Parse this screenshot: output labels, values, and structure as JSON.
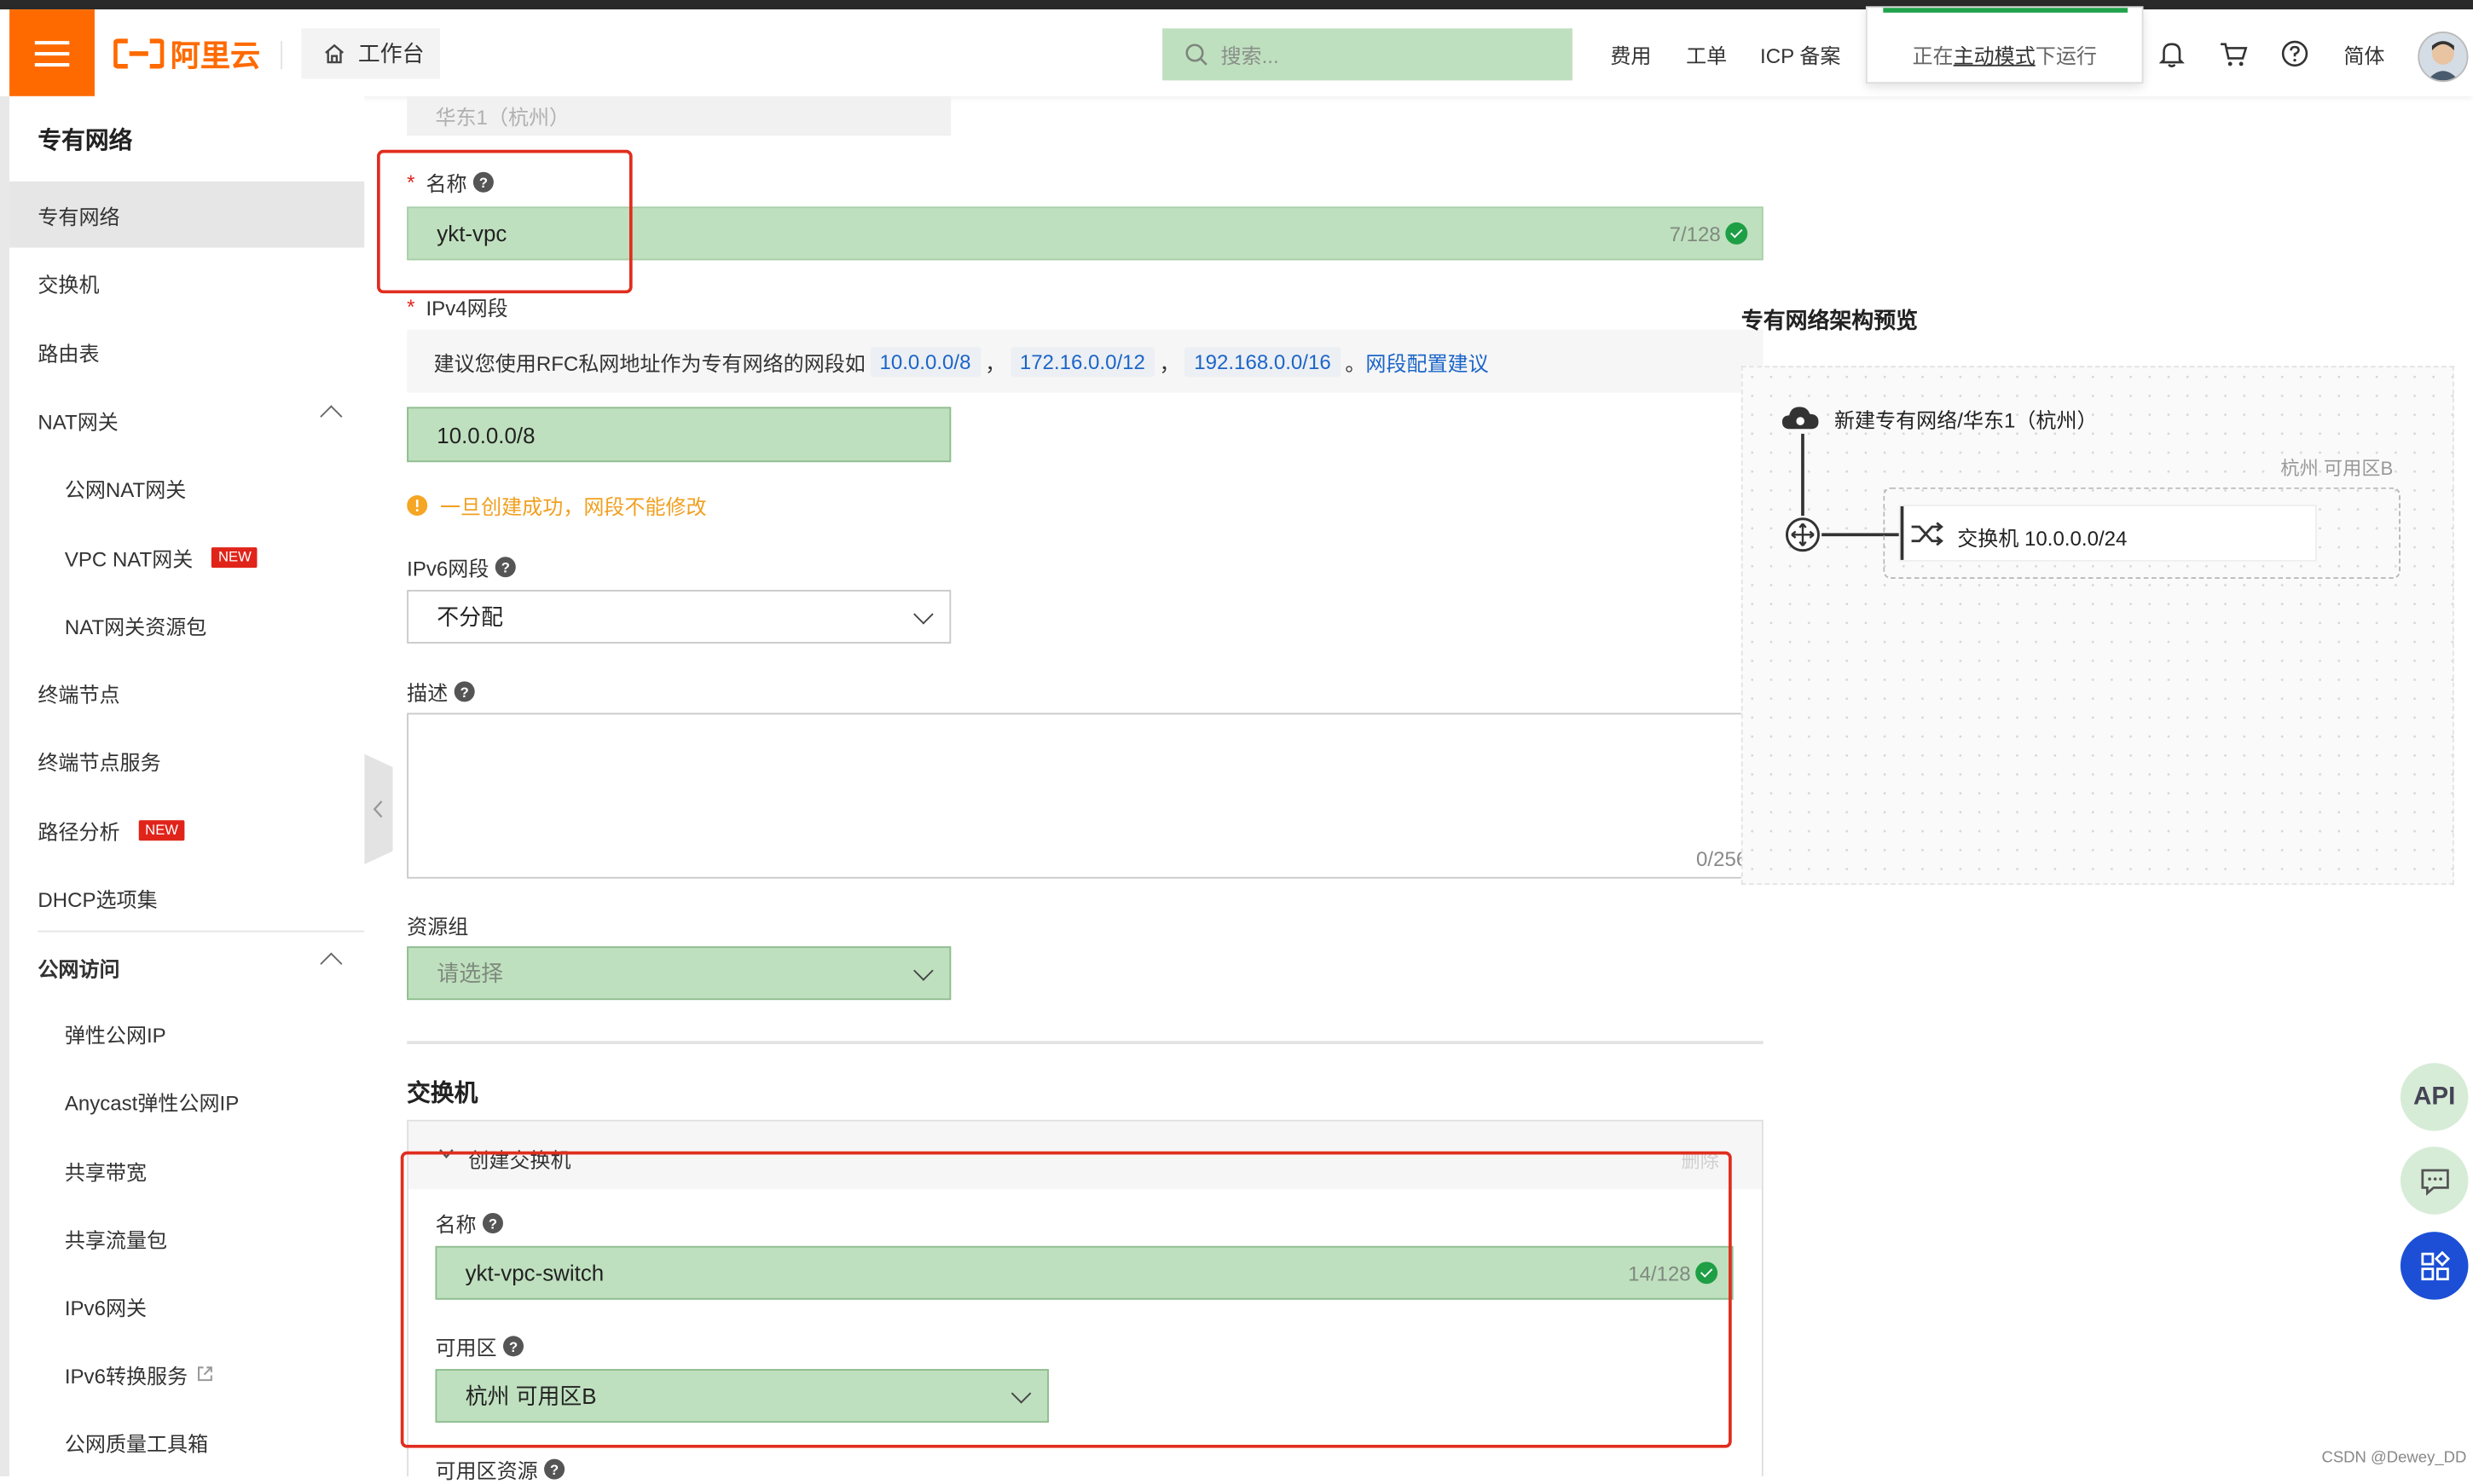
{
  "header": {
    "brand": "阿里云",
    "workbench": "工作台",
    "search_placeholder": "搜索...",
    "links": [
      "费用",
      "工单",
      "ICP 备案"
    ],
    "mode_prefix": "正在",
    "mode_link": "主动模式",
    "mode_suffix": "下运行",
    "lang": "简体"
  },
  "sidebar": {
    "title": "专有网络",
    "items": [
      {
        "label": "专有网络"
      },
      {
        "label": "交换机"
      },
      {
        "label": "路由表"
      },
      {
        "label": "NAT网关"
      },
      {
        "label": "公网NAT网关"
      },
      {
        "label": "VPC NAT网关",
        "badge": "NEW"
      },
      {
        "label": "NAT网关资源包"
      },
      {
        "label": "终端节点"
      },
      {
        "label": "终端节点服务"
      },
      {
        "label": "路径分析",
        "badge": "NEW"
      },
      {
        "label": "DHCP选项集"
      },
      {
        "label": "公网访问"
      },
      {
        "label": "弹性公网IP"
      },
      {
        "label": "Anycast弹性公网IP"
      },
      {
        "label": "共享带宽"
      },
      {
        "label": "共享流量包"
      },
      {
        "label": "IPv6网关"
      },
      {
        "label": "IPv6转换服务"
      },
      {
        "label": "公网质量工具箱"
      }
    ]
  },
  "form": {
    "region_value": "华东1（杭州）",
    "name_label": "名称",
    "name_value": "ykt-vpc",
    "name_counter": "7/128",
    "ipv4_label": "IPv4网段",
    "ipv4_hint": "建议您使用RFC私网地址作为专有网络的网段如",
    "cidr_tags": [
      "10.0.0.0/8",
      "172.16.0.0/12",
      "192.168.0.0/16"
    ],
    "cidr_sep": "，",
    "hint_end": "。",
    "cidr_advice_link": "网段配置建议",
    "ipv4_value": "10.0.0.0/8",
    "ipv4_warning": "一旦创建成功，网段不能修改",
    "ipv6_label": "IPv6网段",
    "ipv6_value": "不分配",
    "desc_label": "描述",
    "desc_counter": "0/256",
    "rg_label": "资源组",
    "rg_placeholder": "请选择",
    "switch_section_title": "交换机",
    "switch_panel_title": "创建交换机",
    "switch_delete": "删除",
    "switch_name_label": "名称",
    "switch_name_value": "ykt-vpc-switch",
    "switch_name_counter": "14/128",
    "zone_label": "可用区",
    "zone_value": "杭州 可用区B",
    "zone_resource_label": "可用区资源"
  },
  "preview": {
    "title": "专有网络架构预览",
    "vpc_node": "新建专有网络/华东1（杭州）",
    "zone_label": "杭州 可用区B",
    "switch_node": "交换机 10.0.0.0/24"
  },
  "fabs": {
    "api": "API"
  },
  "watermark": "CSDN @Dewey_DD",
  "colors": {
    "brand_orange": "#ff6a00",
    "filled_field_green": "#bfe0bf",
    "highlight_red": "#e02d1e",
    "link_blue": "#1b65c8",
    "success_green": "#1e9e45"
  }
}
